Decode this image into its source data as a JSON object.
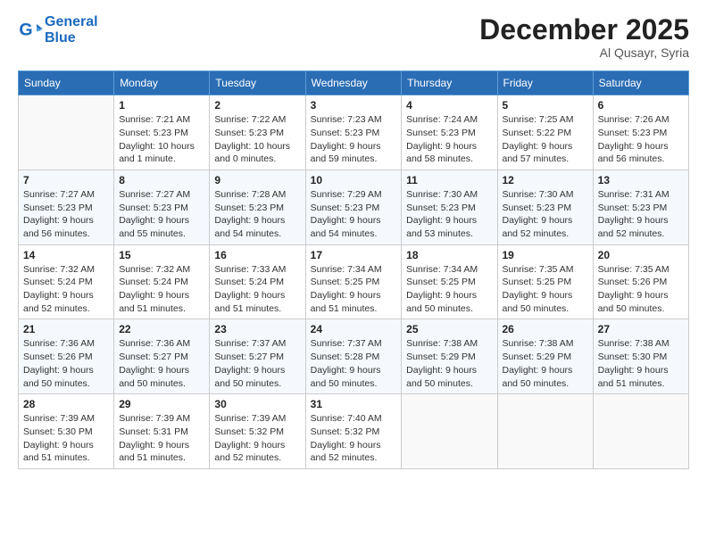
{
  "logo": {
    "line1": "General",
    "line2": "Blue"
  },
  "title": "December 2025",
  "location": "Al Qusayr, Syria",
  "days_of_week": [
    "Sunday",
    "Monday",
    "Tuesday",
    "Wednesday",
    "Thursday",
    "Friday",
    "Saturday"
  ],
  "weeks": [
    [
      {
        "day": "",
        "sunrise": "",
        "sunset": "",
        "daylight": ""
      },
      {
        "day": "1",
        "sunrise": "Sunrise: 7:21 AM",
        "sunset": "Sunset: 5:23 PM",
        "daylight": "Daylight: 10 hours and 1 minute."
      },
      {
        "day": "2",
        "sunrise": "Sunrise: 7:22 AM",
        "sunset": "Sunset: 5:23 PM",
        "daylight": "Daylight: 10 hours and 0 minutes."
      },
      {
        "day": "3",
        "sunrise": "Sunrise: 7:23 AM",
        "sunset": "Sunset: 5:23 PM",
        "daylight": "Daylight: 9 hours and 59 minutes."
      },
      {
        "day": "4",
        "sunrise": "Sunrise: 7:24 AM",
        "sunset": "Sunset: 5:23 PM",
        "daylight": "Daylight: 9 hours and 58 minutes."
      },
      {
        "day": "5",
        "sunrise": "Sunrise: 7:25 AM",
        "sunset": "Sunset: 5:22 PM",
        "daylight": "Daylight: 9 hours and 57 minutes."
      },
      {
        "day": "6",
        "sunrise": "Sunrise: 7:26 AM",
        "sunset": "Sunset: 5:23 PM",
        "daylight": "Daylight: 9 hours and 56 minutes."
      }
    ],
    [
      {
        "day": "7",
        "sunrise": "Sunrise: 7:27 AM",
        "sunset": "Sunset: 5:23 PM",
        "daylight": "Daylight: 9 hours and 56 minutes."
      },
      {
        "day": "8",
        "sunrise": "Sunrise: 7:27 AM",
        "sunset": "Sunset: 5:23 PM",
        "daylight": "Daylight: 9 hours and 55 minutes."
      },
      {
        "day": "9",
        "sunrise": "Sunrise: 7:28 AM",
        "sunset": "Sunset: 5:23 PM",
        "daylight": "Daylight: 9 hours and 54 minutes."
      },
      {
        "day": "10",
        "sunrise": "Sunrise: 7:29 AM",
        "sunset": "Sunset: 5:23 PM",
        "daylight": "Daylight: 9 hours and 54 minutes."
      },
      {
        "day": "11",
        "sunrise": "Sunrise: 7:30 AM",
        "sunset": "Sunset: 5:23 PM",
        "daylight": "Daylight: 9 hours and 53 minutes."
      },
      {
        "day": "12",
        "sunrise": "Sunrise: 7:30 AM",
        "sunset": "Sunset: 5:23 PM",
        "daylight": "Daylight: 9 hours and 52 minutes."
      },
      {
        "day": "13",
        "sunrise": "Sunrise: 7:31 AM",
        "sunset": "Sunset: 5:23 PM",
        "daylight": "Daylight: 9 hours and 52 minutes."
      }
    ],
    [
      {
        "day": "14",
        "sunrise": "Sunrise: 7:32 AM",
        "sunset": "Sunset: 5:24 PM",
        "daylight": "Daylight: 9 hours and 52 minutes."
      },
      {
        "day": "15",
        "sunrise": "Sunrise: 7:32 AM",
        "sunset": "Sunset: 5:24 PM",
        "daylight": "Daylight: 9 hours and 51 minutes."
      },
      {
        "day": "16",
        "sunrise": "Sunrise: 7:33 AM",
        "sunset": "Sunset: 5:24 PM",
        "daylight": "Daylight: 9 hours and 51 minutes."
      },
      {
        "day": "17",
        "sunrise": "Sunrise: 7:34 AM",
        "sunset": "Sunset: 5:25 PM",
        "daylight": "Daylight: 9 hours and 51 minutes."
      },
      {
        "day": "18",
        "sunrise": "Sunrise: 7:34 AM",
        "sunset": "Sunset: 5:25 PM",
        "daylight": "Daylight: 9 hours and 50 minutes."
      },
      {
        "day": "19",
        "sunrise": "Sunrise: 7:35 AM",
        "sunset": "Sunset: 5:25 PM",
        "daylight": "Daylight: 9 hours and 50 minutes."
      },
      {
        "day": "20",
        "sunrise": "Sunrise: 7:35 AM",
        "sunset": "Sunset: 5:26 PM",
        "daylight": "Daylight: 9 hours and 50 minutes."
      }
    ],
    [
      {
        "day": "21",
        "sunrise": "Sunrise: 7:36 AM",
        "sunset": "Sunset: 5:26 PM",
        "daylight": "Daylight: 9 hours and 50 minutes."
      },
      {
        "day": "22",
        "sunrise": "Sunrise: 7:36 AM",
        "sunset": "Sunset: 5:27 PM",
        "daylight": "Daylight: 9 hours and 50 minutes."
      },
      {
        "day": "23",
        "sunrise": "Sunrise: 7:37 AM",
        "sunset": "Sunset: 5:27 PM",
        "daylight": "Daylight: 9 hours and 50 minutes."
      },
      {
        "day": "24",
        "sunrise": "Sunrise: 7:37 AM",
        "sunset": "Sunset: 5:28 PM",
        "daylight": "Daylight: 9 hours and 50 minutes."
      },
      {
        "day": "25",
        "sunrise": "Sunrise: 7:38 AM",
        "sunset": "Sunset: 5:29 PM",
        "daylight": "Daylight: 9 hours and 50 minutes."
      },
      {
        "day": "26",
        "sunrise": "Sunrise: 7:38 AM",
        "sunset": "Sunset: 5:29 PM",
        "daylight": "Daylight: 9 hours and 50 minutes."
      },
      {
        "day": "27",
        "sunrise": "Sunrise: 7:38 AM",
        "sunset": "Sunset: 5:30 PM",
        "daylight": "Daylight: 9 hours and 51 minutes."
      }
    ],
    [
      {
        "day": "28",
        "sunrise": "Sunrise: 7:39 AM",
        "sunset": "Sunset: 5:30 PM",
        "daylight": "Daylight: 9 hours and 51 minutes."
      },
      {
        "day": "29",
        "sunrise": "Sunrise: 7:39 AM",
        "sunset": "Sunset: 5:31 PM",
        "daylight": "Daylight: 9 hours and 51 minutes."
      },
      {
        "day": "30",
        "sunrise": "Sunrise: 7:39 AM",
        "sunset": "Sunset: 5:32 PM",
        "daylight": "Daylight: 9 hours and 52 minutes."
      },
      {
        "day": "31",
        "sunrise": "Sunrise: 7:40 AM",
        "sunset": "Sunset: 5:32 PM",
        "daylight": "Daylight: 9 hours and 52 minutes."
      },
      {
        "day": "",
        "sunrise": "",
        "sunset": "",
        "daylight": ""
      },
      {
        "day": "",
        "sunrise": "",
        "sunset": "",
        "daylight": ""
      },
      {
        "day": "",
        "sunrise": "",
        "sunset": "",
        "daylight": ""
      }
    ]
  ]
}
